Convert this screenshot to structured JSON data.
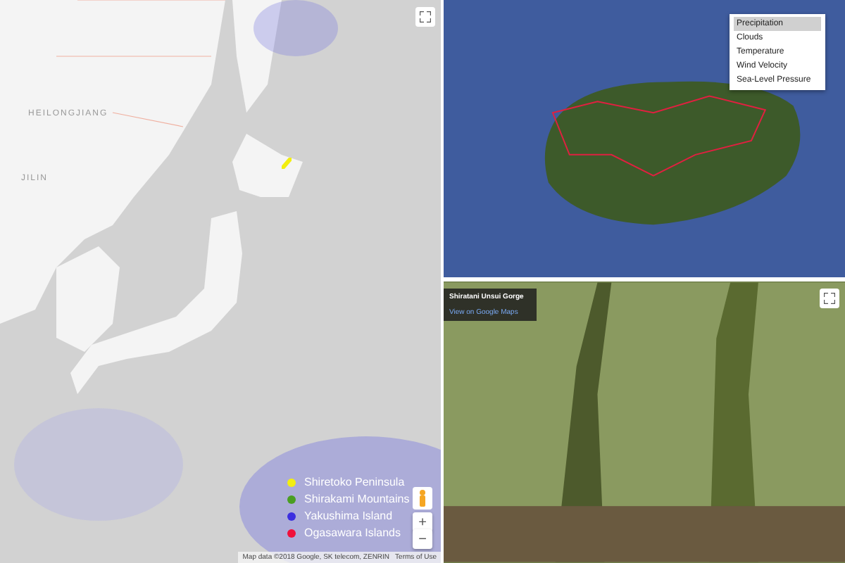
{
  "map": {
    "region_labels": [
      "HEILONGJIANG",
      "JILIN"
    ],
    "legend": [
      {
        "label": "Shiretoko Peninsula",
        "color": "#f2ee10"
      },
      {
        "label": "Shirakami Mountains",
        "color": "#4a9e22"
      },
      {
        "label": "Yakushima Island",
        "color": "#3c2ee0"
      },
      {
        "label": "Ogasawara Islands",
        "color": "#f0103c"
      }
    ],
    "zoom_in": "+",
    "zoom_out": "−",
    "attribution": "Map data ©2018 Google, SK telecom, ZENRIN",
    "terms": "Terms of Use"
  },
  "layers": [
    {
      "label": "Precipitation",
      "selected": true
    },
    {
      "label": "Clouds",
      "selected": false
    },
    {
      "label": "Temperature",
      "selected": false
    },
    {
      "label": "Wind Velocity",
      "selected": false
    },
    {
      "label": "Sea-Level Pressure",
      "selected": false
    }
  ],
  "street_view": {
    "title": "Shiratani Unsui Gorge",
    "link": "View on Google Maps"
  }
}
